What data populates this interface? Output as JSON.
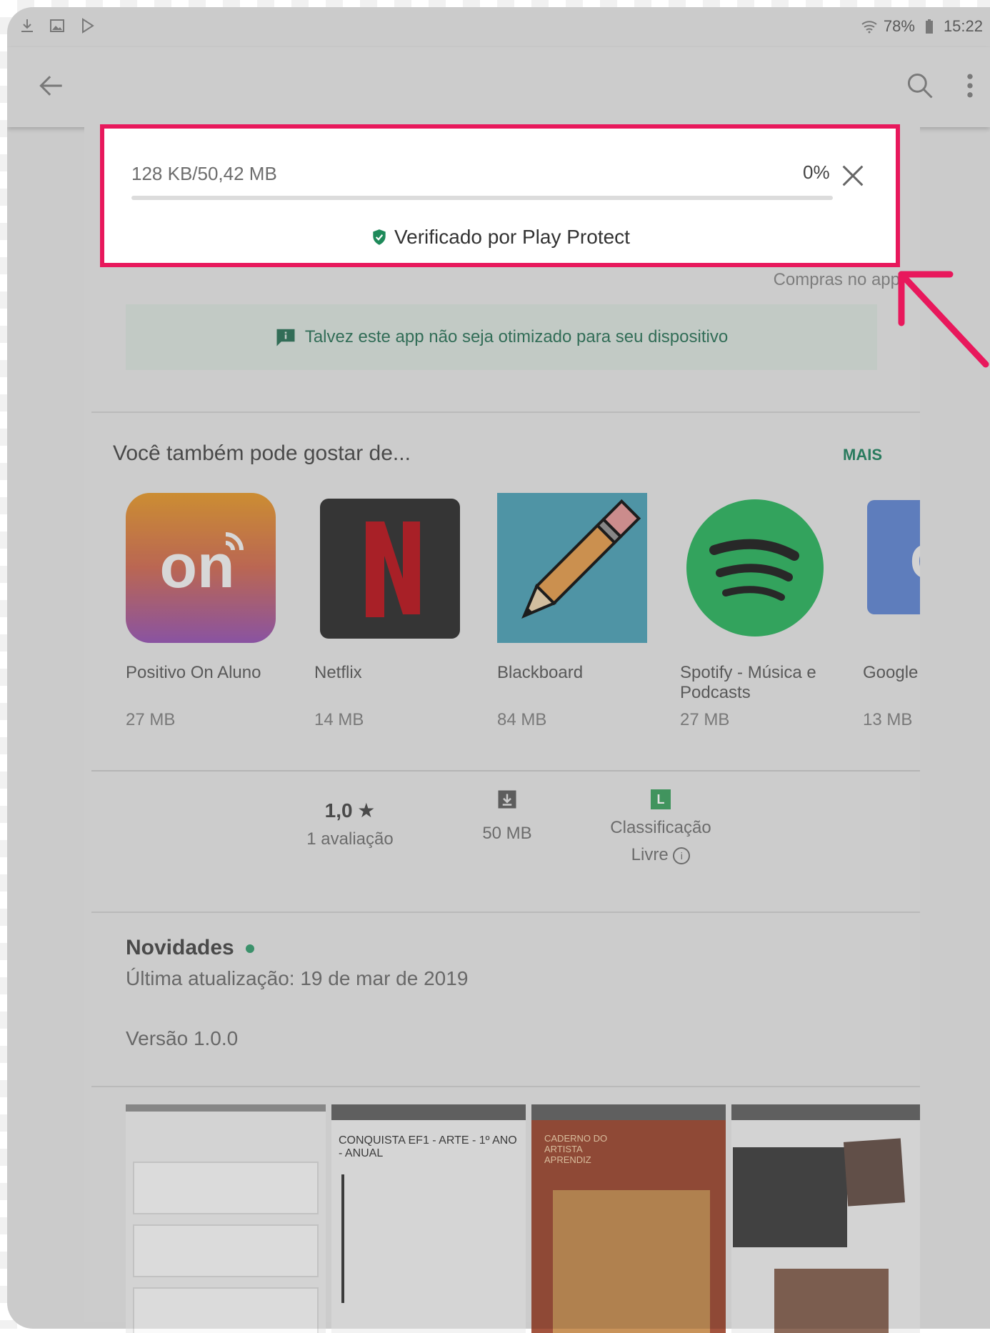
{
  "status_bar": {
    "battery_percent": "78%",
    "time": "15:22",
    "left_icons": [
      "download-icon",
      "image-icon",
      "play-store-icon"
    ],
    "right_icons": [
      "wifi-icon",
      "battery-icon"
    ]
  },
  "toolbar": {
    "back_icon": "arrow-back-icon",
    "search_icon": "search-icon",
    "more_icon": "more-vert-icon"
  },
  "download": {
    "progress_text": "128 KB/50,42 MB",
    "percent": "0%",
    "progress_fraction": 0.0,
    "verified_text": "Verificado por Play Protect",
    "highlight_color": "#e8185c"
  },
  "purchases_text": "Compras no app",
  "optimization_banner": "Talvez este app não seja otimizado para seu dispositivo",
  "recommendations": {
    "title": "Você também pode gostar de...",
    "more_label": "MAIS",
    "apps": [
      {
        "name": "Positivo On Aluno",
        "size": "27 MB"
      },
      {
        "name": "Netflix",
        "size": "14 MB"
      },
      {
        "name": "Blackboard",
        "size": "84 MB"
      },
      {
        "name": "Spotify - Música e Podcasts",
        "size": "27 MB"
      },
      {
        "name": "Google",
        "size": "13 MB"
      }
    ]
  },
  "stats": {
    "rating": "1,0",
    "rating_count": "1 avaliação",
    "size": "50 MB",
    "classification_label": "Classificação",
    "classification_value": "Livre",
    "classification_badge": "L"
  },
  "news": {
    "title": "Novidades",
    "updated": "Última atualização: 19 de mar de 2019",
    "version": "Versão 1.0.0"
  },
  "screenshots": {
    "shot2_title": "CONQUISTA EF1 - ARTE - 1º ANO - ANUAL",
    "shot3_title": "CADERNO DO ARTISTA APRENDIZ"
  },
  "accent_colors": {
    "green": "#2f8c6c",
    "highlight": "#e8185c"
  }
}
